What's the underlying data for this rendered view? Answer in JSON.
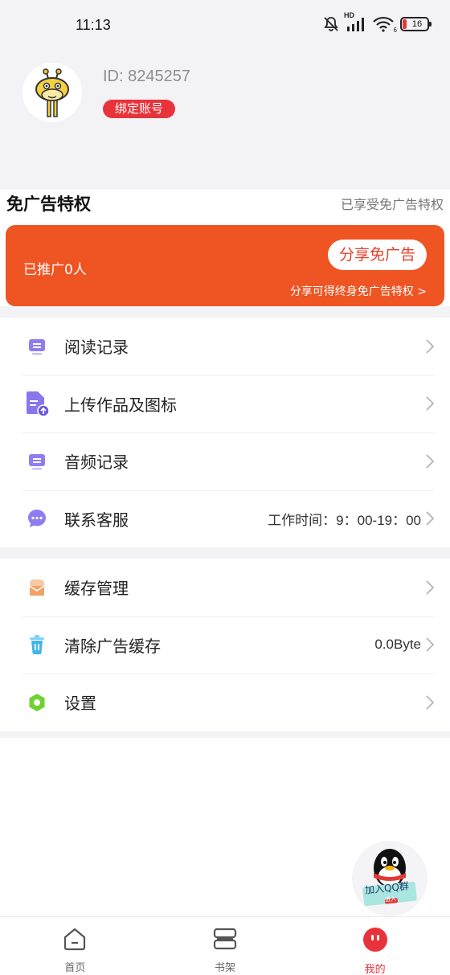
{
  "status_bar": {
    "time": "11:13",
    "hd_label": "HD",
    "wifi_sub": "6",
    "battery": "16"
  },
  "profile": {
    "id_text": "ID: 8245257",
    "bind_label": "绑定账号",
    "avatar_icon": "giraffe-avatar"
  },
  "adfree": {
    "title": "免广告特权",
    "status": "已享受免广告特权",
    "promo_count": "已推广0人",
    "share_button": "分享免广告",
    "share_hint": "分享可得终身免广告特权 >"
  },
  "menu_group_1": [
    {
      "label": "阅读记录",
      "value": "",
      "icon": "reading-record-icon",
      "color": "#8f7cf0"
    },
    {
      "label": "上传作品及图标",
      "value": "",
      "icon": "upload-document-icon",
      "color": "#8a75ee"
    },
    {
      "label": "音频记录",
      "value": "",
      "icon": "audio-record-icon",
      "color": "#8f7cf0"
    },
    {
      "label": "联系客服",
      "value": "工作时间：9：00-19：00",
      "icon": "chat-bubble-icon",
      "color": "#8f7cf0"
    }
  ],
  "menu_group_2": [
    {
      "label": "缓存管理",
      "value": "",
      "icon": "cache-box-icon",
      "color": "#f0a267"
    },
    {
      "label": "清除广告缓存",
      "value": "0.0Byte",
      "icon": "trash-icon",
      "color": "#3fb6e8"
    },
    {
      "label": "设置",
      "value": "",
      "icon": "settings-hexagon-icon",
      "color": "#6fd22f"
    }
  ],
  "qq_float": {
    "label": "加入QQ群",
    "sub": "进入"
  },
  "bottom_nav": [
    {
      "label": "首页",
      "icon": "home-icon",
      "active": false
    },
    {
      "label": "书架",
      "icon": "bookshelf-icon",
      "active": false
    },
    {
      "label": "我的",
      "icon": "profile-icon",
      "active": true
    }
  ],
  "colors": {
    "accent_red": "#e8333a",
    "promo_orange": "#ef5423",
    "background_gray": "#f3f3f6"
  }
}
